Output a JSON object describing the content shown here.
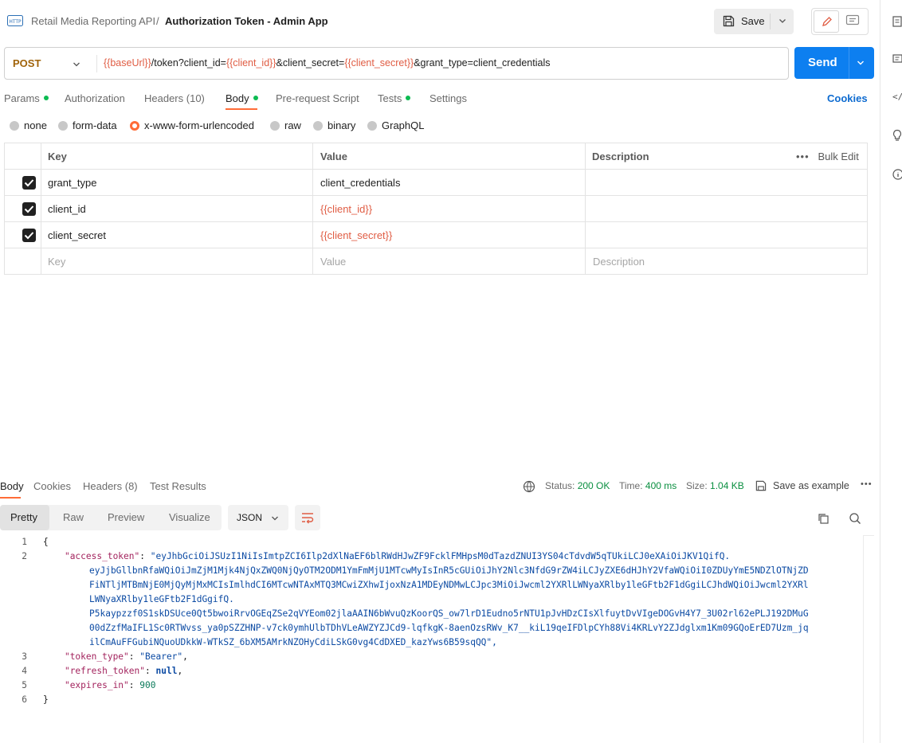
{
  "breadcrumb": {
    "collection": "Retail Media Reporting API",
    "separator": "/",
    "request_name": "Authorization Token - Admin App"
  },
  "toolbar": {
    "save_label": "Save"
  },
  "request": {
    "method": "POST",
    "url_parts": {
      "base_var": "{{baseUrl}}",
      "p1": "/token?client_id=",
      "client_id_var": "{{client_id}}",
      "p2": "&client_secret=",
      "client_secret_var": "{{client_secret}}",
      "p3": "&grant_type=client_credentials"
    },
    "send_label": "Send"
  },
  "request_tabs": {
    "params": "Params",
    "authorization": "Authorization",
    "headers": "Headers",
    "headers_count": "(10)",
    "body": "Body",
    "prerequest": "Pre-request Script",
    "tests": "Tests",
    "settings": "Settings",
    "cookies": "Cookies"
  },
  "body_types": {
    "none": "none",
    "form_data": "form-data",
    "urlencoded": "x-www-form-urlencoded",
    "raw": "raw",
    "binary": "binary",
    "graphql": "GraphQL",
    "selected": "x-www-form-urlencoded"
  },
  "params_table": {
    "headers": {
      "key": "Key",
      "value": "Value",
      "description": "Description",
      "bulk_edit": "Bulk Edit"
    },
    "rows": [
      {
        "key": "grant_type",
        "value": "client_credentials",
        "checked": true
      },
      {
        "key": "client_id",
        "value": "{{client_id}}",
        "checked": true
      },
      {
        "key": "client_secret",
        "value": "{{client_secret}}",
        "checked": true
      }
    ],
    "placeholder": {
      "key": "Key",
      "value": "Value",
      "description": "Description"
    }
  },
  "response": {
    "tabs": {
      "body": "Body",
      "cookies": "Cookies",
      "headers": "Headers (8)",
      "test_results": "Test Results"
    },
    "status_label": "Status:",
    "status_value": "200 OK",
    "time_label": "Time:",
    "time_value": "400 ms",
    "size_label": "Size:",
    "size_value": "1.04 KB",
    "save_example": "Save as example",
    "views": {
      "pretty": "Pretty",
      "raw": "Raw",
      "preview": "Preview",
      "visualize": "Visualize"
    },
    "format": "JSON",
    "json": {
      "open": "{",
      "close": "}",
      "access_token_key": "\"access_token\"",
      "access_token_lines": [
        "\"eyJhbGciOiJSUzI1NiIsImtpZCI6Ilp2dXlNaEF6blRWdHJwZF9FcklFMHpsM0dTazdZNUI3YS04cTdvdW5qTUkiLCJ0eXAiOiJKV1QifQ.",
        "eyJjbGllbnRfaWQiOiJmZjM1Mjk4NjQxZWQ0NjQyOTM2ODM1YmFmMjU1MTcwMyIsInR5cGUiOiJhY2Nlc3NfdG9rZW4iLCJyZXE6dHJhY2VfaWQiOiI0ZDUyYmE5NDZlOTNjZD",
        "FiNTljMTBmNjE0MjQyMjMxMCIsImlhdCI6MTcwNTAxMTQ3MCwiZXhwIjoxNzA1MDEyNDMwLCJpc3MiOiJwcml2YXRlLWNyaXRlby1leGFtb2F1dGgiLCJhdWQiOiJwcml2YXRl",
        "LWNyaXRlby1leGFtb2F1dGgifQ.",
        "P5kaypzzf0S1skDSUce0Qt5bwoiRrvOGEqZSe2qVYEom02jlaAAIN6bWvuQzKoorQS_ow7lrD1Eudno5rNTU1pJvHDzCIsXlfuytDvVIgeDOGvH4Y7_3U02rl62ePLJ192DMuG",
        "00dZzfMaIFL1Sc0RTWvss_ya0pSZZHNP-v7ck0ymhUlbTDhVLeAWZYZJCd9-lqfkgK-8aenOzsRWv_K7__kiL19qeIFDlpCYh88Vi4KRLvY2ZJdglxm1Km09GQoErED7Uzm_jq",
        "ilCmAuFFGubiNQuoUDkkW-WTkSZ_6bXM5AMrkNZOHyCdiLSkG0vg4CdDXED_kazYws6B59sqQQ\","
      ],
      "token_type_key": "\"token_type\"",
      "token_type_value": "\"Bearer\"",
      "refresh_token_key": "\"refresh_token\"",
      "refresh_token_value": "null",
      "expires_in_key": "\"expires_in\"",
      "expires_in_value": "900"
    },
    "line_numbers": [
      "1",
      "2",
      "3",
      "4",
      "5",
      "6"
    ]
  },
  "colors": {
    "accent": "#ff6c37",
    "send": "#0d7ff0",
    "method": "#a0630a",
    "variable": "#e05d44",
    "status_ok": "#0a8f40"
  },
  "icons": {
    "request_type": "http-icon",
    "save": "floppy-icon",
    "edit": "pencil-icon",
    "comment": "comment-icon",
    "wrap": "wrap-lines-icon",
    "copy": "copy-icon",
    "search": "search-icon",
    "globe": "globe-icon"
  }
}
